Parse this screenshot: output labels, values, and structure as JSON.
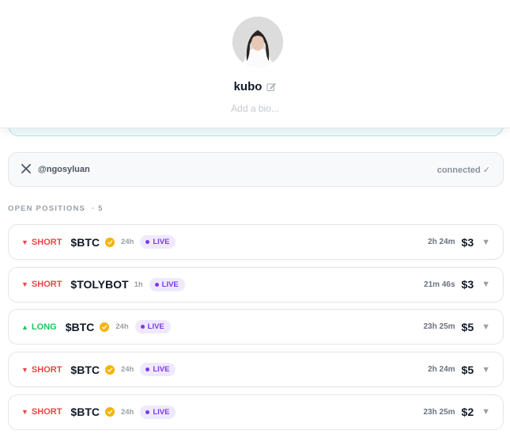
{
  "profile": {
    "username": "kubo",
    "bio_placeholder": "Add a bio..."
  },
  "connected_account": {
    "handle": "@ngosyluan",
    "status": "connected ✓"
  },
  "open_positions": {
    "label": "OPEN POSITIONS",
    "count_label": "· 5",
    "items": [
      {
        "side": "SHORT",
        "direction": "short",
        "ticker": "$BTC",
        "verified": true,
        "duration": "24h",
        "badge": "LIVE",
        "time_left": "2h 24m",
        "amount": "$3"
      },
      {
        "side": "SHORT",
        "direction": "short",
        "ticker": "$TOLYBOT",
        "verified": false,
        "duration": "1h",
        "badge": "LIVE",
        "time_left": "21m 46s",
        "amount": "$3"
      },
      {
        "side": "LONG",
        "direction": "long",
        "ticker": "$BTC",
        "verified": true,
        "duration": "24h",
        "badge": "LIVE",
        "time_left": "23h 25m",
        "amount": "$5"
      },
      {
        "side": "SHORT",
        "direction": "short",
        "ticker": "$BTC",
        "verified": true,
        "duration": "24h",
        "badge": "LIVE",
        "time_left": "2h 24m",
        "amount": "$5"
      },
      {
        "side": "SHORT",
        "direction": "short",
        "ticker": "$BTC",
        "verified": true,
        "duration": "24h",
        "badge": "LIVE",
        "time_left": "23h 25m",
        "amount": "$2"
      }
    ]
  },
  "colors": {
    "short": "#ef4444",
    "long": "#22c55e",
    "live": "#7c3aed",
    "verified": "#f5b40b"
  },
  "icons": {
    "edit": "pencil-icon",
    "platform": "x-logo-icon",
    "short": "triangle-down",
    "long": "triangle-up",
    "expand": "chevron-down"
  }
}
